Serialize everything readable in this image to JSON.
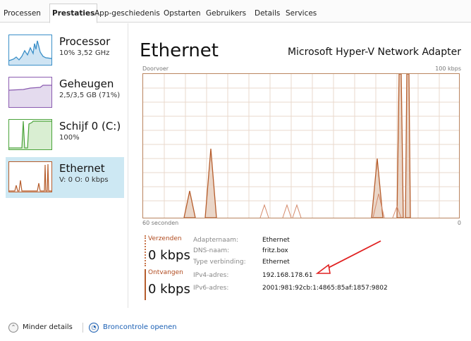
{
  "tabs": [
    {
      "label": "Processen"
    },
    {
      "label": "Prestaties"
    },
    {
      "label": "App-geschiedenis"
    },
    {
      "label": "Opstarten"
    },
    {
      "label": "Gebruikers"
    },
    {
      "label": "Details"
    },
    {
      "label": "Services"
    }
  ],
  "active_tab": "Prestaties",
  "sidebar": {
    "items": [
      {
        "title": "Processor",
        "sub": "10% 3,52 GHz",
        "color": "#3a8fc8"
      },
      {
        "title": "Geheugen",
        "sub": "2,5/3,5 GB (71%)",
        "color": "#8a5bb0"
      },
      {
        "title": "Schijf 0 (C:)",
        "sub": "100%",
        "color": "#4aa33a"
      },
      {
        "title": "Ethernet",
        "sub": "V: 0 O: 0 kbps",
        "color": "#b65d2c"
      }
    ],
    "selected": "Ethernet"
  },
  "main": {
    "title": "Ethernet",
    "adapter": "Microsoft Hyper-V Network Adapter",
    "graph": {
      "top_left_label": "Doorvoer",
      "top_right_label": "100 kbps",
      "bottom_left_label": "60 seconden",
      "bottom_right_label": "0",
      "line_color": "#b65d2c",
      "fill_color": "#ead6c8",
      "grid_color": "#e9d9cd"
    },
    "send": {
      "label": "Verzenden",
      "value": "0 kbps"
    },
    "receive": {
      "label": "Ontvangen",
      "value": "0 kbps"
    },
    "info": [
      {
        "key": "Adapternaam:",
        "value": "Ethernet"
      },
      {
        "key": "DNS-naam:",
        "value": "fritz.box"
      },
      {
        "key": "Type verbinding:",
        "value": "Ethernet"
      },
      {
        "key": "IPv4-adres:",
        "value": "192.168.178.61"
      },
      {
        "key": "IPv6-adres:",
        "value": "2001:981:92cb:1:4865:85af:1857:9802"
      }
    ]
  },
  "footer": {
    "less_details": "Minder details",
    "open_monitor": "Broncontrole openen",
    "link_color": "#1a5fb4"
  }
}
